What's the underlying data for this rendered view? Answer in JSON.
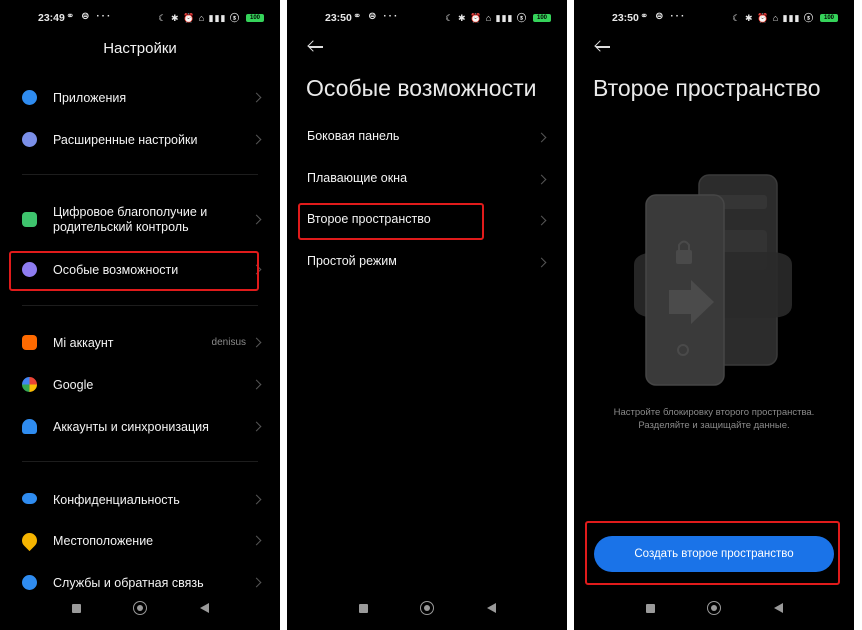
{
  "screen1": {
    "status": {
      "time": "23:49"
    },
    "title": "Настройки",
    "items": [
      {
        "label": "Приложения",
        "icon": "gear-icon",
        "color": "#2f8cf0"
      },
      {
        "label": "Расширенные настройки",
        "icon": "dots-icon",
        "color": "#7b8fe8"
      },
      {
        "label": "Цифровое благополучие и родительский контроль",
        "icon": "wellbeing-icon",
        "color": "#3ec46d"
      },
      {
        "label": "Особые возможности",
        "icon": "accessibility-icon",
        "color": "#8e7cf0"
      },
      {
        "label": "Mi аккаунт",
        "icon": "mi-icon",
        "color": "#ff6a00",
        "aux": "denisus"
      },
      {
        "label": "Google",
        "icon": "google-icon",
        "color": "#4285f4"
      },
      {
        "label": "Аккаунты и синхронизация",
        "icon": "person-icon",
        "color": "#2f8cf0"
      },
      {
        "label": "Конфиденциальность",
        "icon": "eye-icon",
        "color": "#2f8cf0"
      },
      {
        "label": "Местоположение",
        "icon": "location-pin-icon",
        "color": "#f5b400"
      },
      {
        "label": "Службы и обратная связь",
        "icon": "help-icon",
        "color": "#2f8cf0"
      }
    ]
  },
  "screen2": {
    "status": {
      "time": "23:50"
    },
    "title": "Особые возможности",
    "items": [
      {
        "label": "Боковая панель"
      },
      {
        "label": "Плавающие окна"
      },
      {
        "label": "Второе пространство"
      },
      {
        "label": "Простой режим"
      }
    ]
  },
  "screen3": {
    "status": {
      "time": "23:50"
    },
    "title": "Второе пространство",
    "description_line1": "Настройте блокировку второго пространства.",
    "description_line2": "Разделяйте и защищайте данные.",
    "button_label": "Создать второе пространство"
  },
  "status_icons": {
    "battery": "100",
    "left": "⚭ ⊜ ···",
    "right": "☾ ✱ ⏰ ⌂ ▮▮▮ ⓢ"
  },
  "colors": {
    "highlight": "#e01b1b",
    "accent": "#1a73e8",
    "background": "#000000"
  }
}
